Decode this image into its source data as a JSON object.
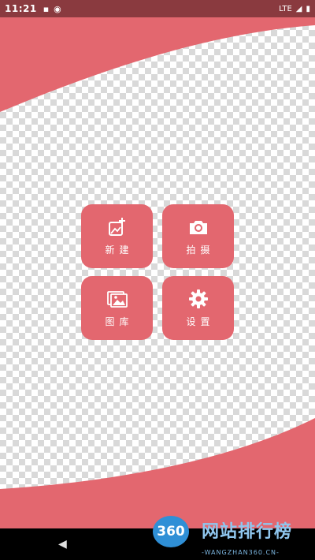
{
  "status_bar": {
    "time": "11:21",
    "network": "LTE",
    "icons": [
      "sd-card-icon",
      "sync-icon",
      "signal-icon",
      "battery-icon"
    ]
  },
  "colors": {
    "accent": "#e3676f",
    "status_bar": "#8a3a3f",
    "nav_bar": "#000000"
  },
  "menu": {
    "new_label": "新建",
    "new_icon": "add-image-icon",
    "camera_label": "拍摄",
    "camera_icon": "camera-icon",
    "gallery_label": "图库",
    "gallery_icon": "gallery-icon",
    "settings_label": "设置",
    "settings_icon": "gear-icon"
  },
  "nav_bar": {
    "back_icon": "back-triangle-icon"
  },
  "watermark": {
    "logo_text": "360",
    "title": "网站排行榜",
    "subtitle": "-WANGZHAN360.CN-"
  }
}
